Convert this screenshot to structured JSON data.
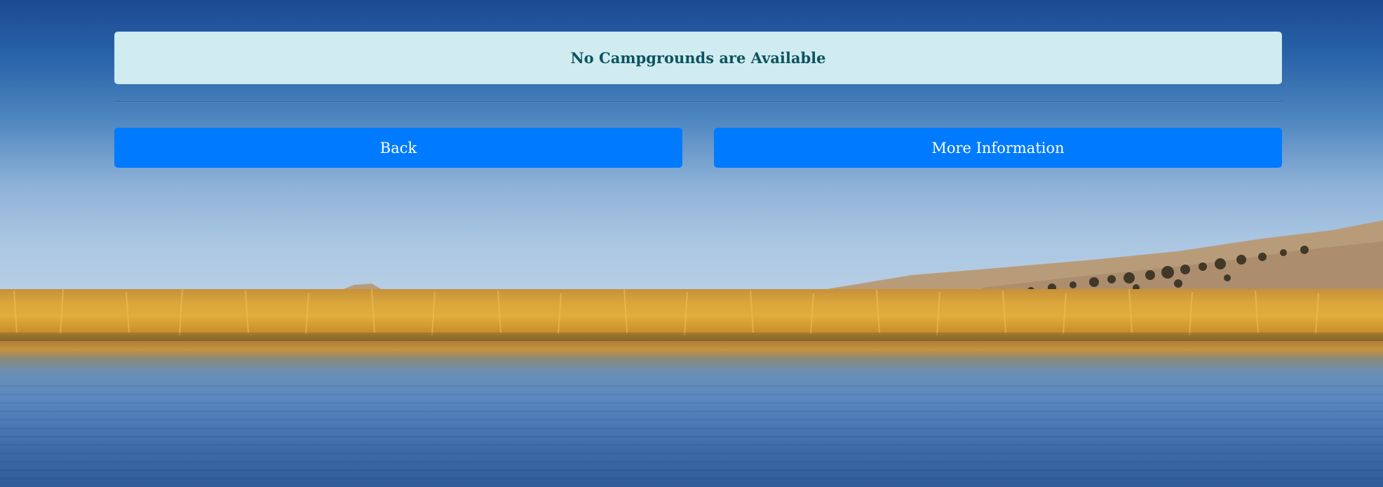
{
  "alert": {
    "message": "No Campgrounds are Available"
  },
  "actions": {
    "back_label": "Back",
    "more_info_label": "More Information"
  },
  "colors": {
    "alert_background": "#d1ecf1",
    "alert_text": "#0c5460",
    "button_background": "#007bff",
    "button_text": "#ffffff"
  }
}
